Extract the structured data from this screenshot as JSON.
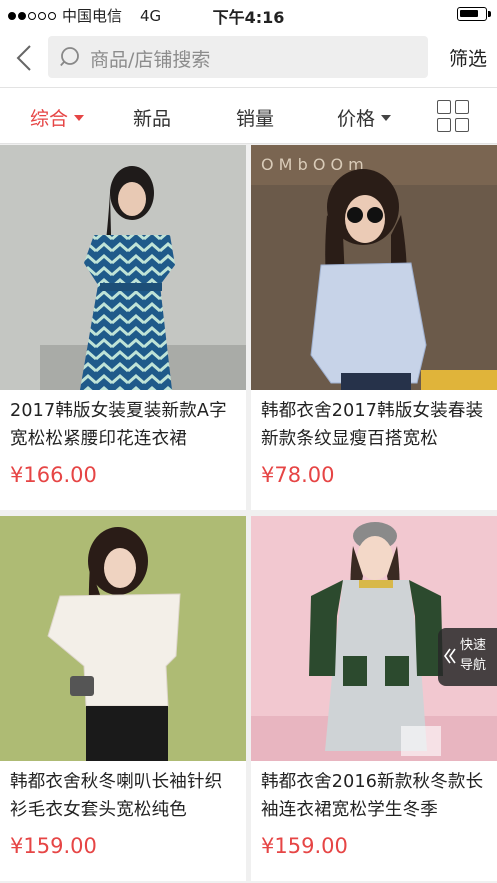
{
  "status_bar": {
    "carrier": "中国电信",
    "network": "4G",
    "time": "下午4:16"
  },
  "search": {
    "placeholder": "商品/店铺搜索",
    "filter_label": "筛选"
  },
  "sort_bar": {
    "items": [
      {
        "label": "综合",
        "active": true,
        "has_caret": true
      },
      {
        "label": "新品",
        "active": false,
        "has_caret": false
      },
      {
        "label": "销量",
        "active": false,
        "has_caret": false
      },
      {
        "label": "价格",
        "active": false,
        "has_caret": true
      }
    ]
  },
  "products": [
    {
      "title": "2017韩版女装夏装新款A字宽松松紧腰印花连衣裙",
      "price": "¥166.00"
    },
    {
      "title": "韩都衣舍2017韩版女装春装新款条纹显瘦百搭宽松",
      "price": "¥78.00"
    },
    {
      "title": "韩都衣舍秋冬喇叭长袖针织衫毛衣女套头宽松纯色",
      "price": "¥159.00"
    },
    {
      "title": "韩都衣舍2016新款秋冬款长袖连衣裙宽松学生冬季",
      "price": "¥159.00"
    }
  ],
  "quick_nav": {
    "line1": "快速",
    "line2": "导航"
  },
  "colors": {
    "accent": "#e64545"
  }
}
